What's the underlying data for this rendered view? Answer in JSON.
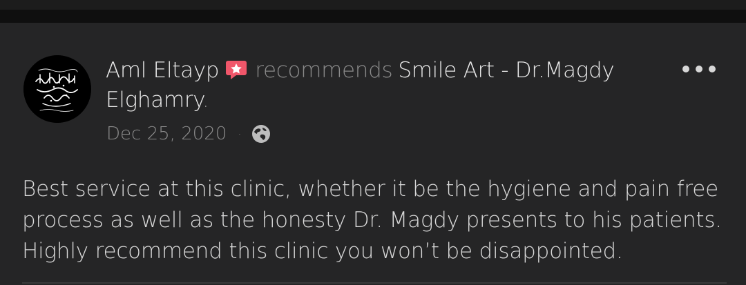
{
  "post": {
    "author": "Aml Eltayp",
    "verb": "recommends",
    "page_name": "Smile Art - Dr.Magdy Elghamry",
    "period": ".",
    "date": "Dec 25, 2020",
    "separator": "·",
    "privacy_icon": "globe-icon",
    "badge_icon": "star-badge-icon",
    "more_icon": "more-dots-icon",
    "review_text": "Best service at this clinic, whether it be the hygiene and pain free process as well as the honesty Dr. Magdy presents to his patients. Highly recommend this clinic you won’t be disappointed."
  },
  "colors": {
    "background": "#0f0f0f",
    "card": "#252526",
    "badge": "#f0566a"
  }
}
